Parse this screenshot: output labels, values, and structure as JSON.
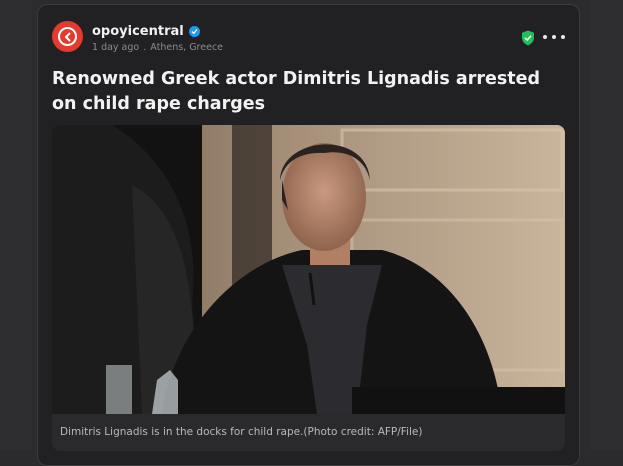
{
  "post": {
    "username": "opoyicentral",
    "time": "1 day ago",
    "separator": ".",
    "location": "Athens, Greece",
    "title": "Renowned Greek actor Dimitris Lignadis arrested on child rape charges",
    "caption": "Dimitris Lignadis is in the docks for child rape.(Photo credit: AFP/File)"
  },
  "icons": {
    "avatar": "logo-icon",
    "verified": "verified-badge-icon",
    "shield": "shield-check-icon",
    "more": "more-options-icon"
  },
  "colors": {
    "background": "#2b2b2d",
    "card": "#212123",
    "brand_red": "#e53a2e",
    "verified_blue": "#1d9bf0",
    "shield_green": "#1fbf5a"
  }
}
